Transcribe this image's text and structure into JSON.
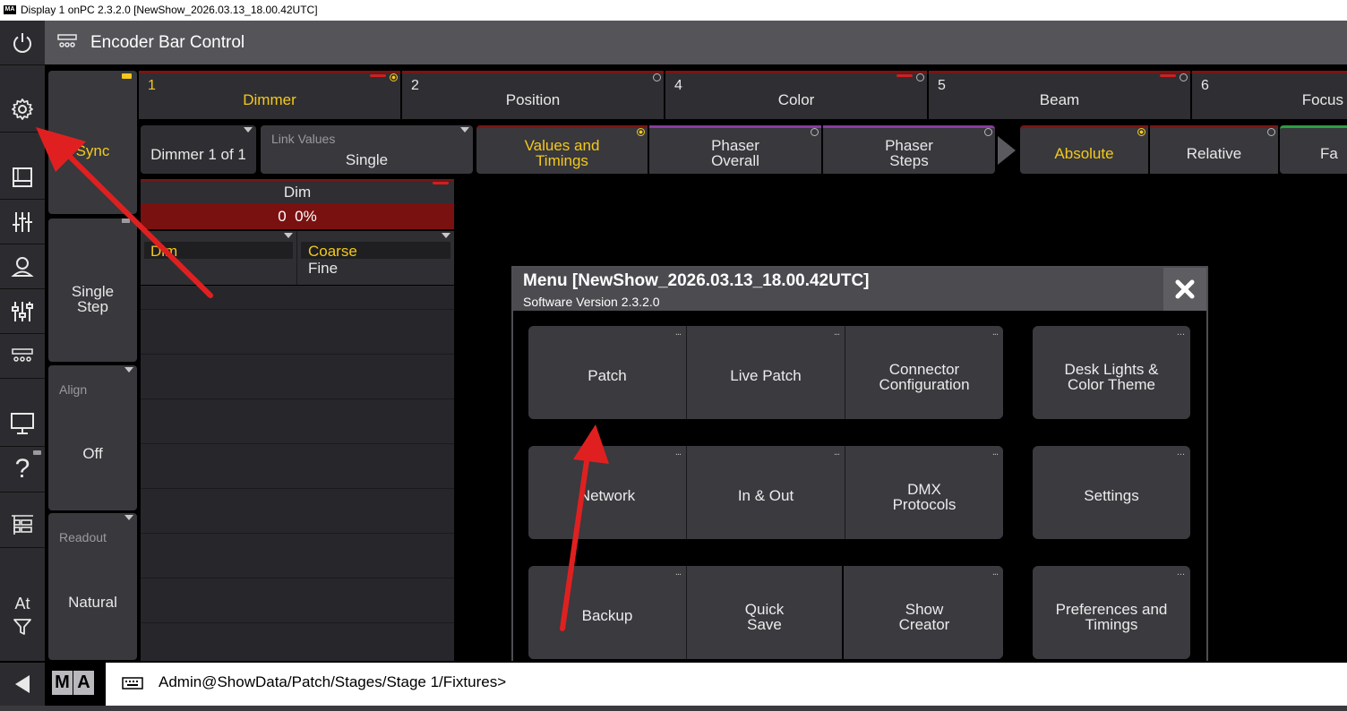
{
  "window": {
    "title": "Display 1 onPC 2.3.2.0 [NewShow_2026.03.13_18.00.42UTC]",
    "logo": "MA"
  },
  "header": {
    "title": "Encoder Bar Control",
    "icon": "encoder-bar-icon"
  },
  "sidebar": {
    "items": [
      {
        "name": "power-icon"
      },
      {
        "name": "gear-icon"
      },
      {
        "name": "window-icon"
      },
      {
        "name": "faders-icon"
      },
      {
        "name": "group-icon"
      },
      {
        "name": "sliders-icon"
      },
      {
        "name": "encoder-bar-icon"
      },
      {
        "name": "monitor-icon"
      },
      {
        "name": "help-icon",
        "label": "?"
      },
      {
        "name": "layout-icon"
      },
      {
        "name": "at-filter-icon",
        "label": "At"
      }
    ]
  },
  "left_column": {
    "sync": "Sync",
    "single_step": "Single\nStep",
    "align_label": "Align",
    "align_value": "Off",
    "readout_label": "Readout",
    "readout_value": "Natural"
  },
  "encoder_tabs": [
    {
      "num": "1",
      "name": "Dimmer",
      "active": true
    },
    {
      "num": "2",
      "name": "Position",
      "active": false
    },
    {
      "num": "4",
      "name": "Color",
      "active": false
    },
    {
      "num": "5",
      "name": "Beam",
      "active": false
    },
    {
      "num": "6",
      "name": "Focus",
      "active": false
    }
  ],
  "row2": {
    "dimmer_count": "Dimmer 1 of 1",
    "link_values_label": "Link Values",
    "link_values_value": "Single",
    "values_timings": "Values and\nTimings",
    "phaser_overall": "Phaser\nOverall",
    "phaser_steps": "Phaser\nSteps",
    "absolute": "Absolute",
    "relative": "Relative",
    "fade": "Fa"
  },
  "dim_panel": {
    "title": "Dim",
    "value": "0",
    "percent": "0%",
    "col1": "Dim",
    "col2_a": "Coarse",
    "col2_b": "Fine"
  },
  "menu": {
    "title": "Menu [NewShow_2026.03.13_18.00.42UTC]",
    "subtitle": "Software Version 2.3.2.0",
    "buttons": {
      "patch": "Patch",
      "live_patch": "Live Patch",
      "connector": "Connector\nConfiguration",
      "desk_lights": "Desk Lights &\nColor Theme",
      "network": "Network",
      "in_out": "In & Out",
      "dmx": "DMX\nProtocols",
      "settings": "Settings",
      "backup": "Backup",
      "quick_save": "Quick\nSave",
      "show_creator": "Show\nCreator",
      "preferences": "Preferences and\nTimings"
    },
    "more": "..."
  },
  "bottom": {
    "ma_m": "M",
    "ma_a": "A",
    "command_line": "Admin@ShowData/Patch/Stages/Stage 1/Fixtures>"
  },
  "colors": {
    "accent_yellow": "#f4c81c",
    "red": "#d31e1e",
    "arrow": "#e02020"
  }
}
